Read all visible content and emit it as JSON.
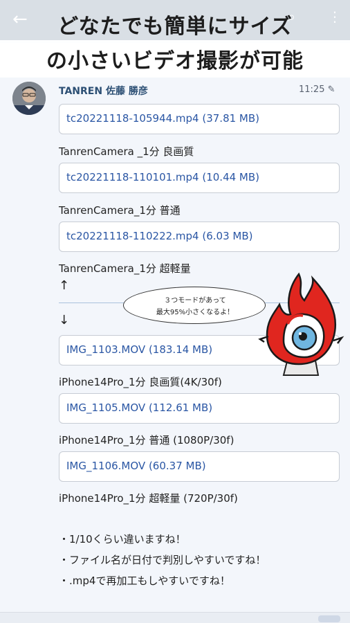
{
  "banner": {
    "line1": "どなたでも簡単にサイズ",
    "line2": "の小さいビデオ撮影が可能"
  },
  "appbar": {
    "back_icon": "←",
    "search_icon": "⌕",
    "more_icon": "⋮"
  },
  "message": {
    "sender": "TANREN 佐藤 勝彦",
    "time": "11:25",
    "edit_icon": "✎",
    "attachments": [
      {
        "file": "tc20221118-105944.mp4 (37.81 MB)",
        "caption": "TanrenCamera _1分 良画質"
      },
      {
        "file": "tc20221118-110101.mp4 (10.44 MB)",
        "caption": "TanrenCamera_1分 普通"
      },
      {
        "file": "tc20221118-110222.mp4 (6.03 MB)",
        "caption": "TanrenCamera_1分 超軽量"
      },
      {
        "file": "IMG_1103.MOV (183.14 MB)",
        "caption": "iPhone14Pro_1分 良画質(4K/30f)"
      },
      {
        "file": "IMG_1105.MOV (112.61 MB)",
        "caption": "iPhone14Pro_1分 普通 (1080P/30f)"
      },
      {
        "file": "IMG_1106.MOV (60.37 MB)",
        "caption": "iPhone14Pro_1分 超軽量 (720P/30f)"
      }
    ],
    "arrow_up": "↑",
    "arrow_down": "↓",
    "bullets": [
      "・1/10くらい違いますね！",
      "・ファイル名が日付で判別しやすいですね！",
      "・.mp4で再加工もしやすいですね！"
    ]
  },
  "mascot_bubble": {
    "line1": "３つモードがあって",
    "line2": "最大95%小さくなるよ！"
  }
}
